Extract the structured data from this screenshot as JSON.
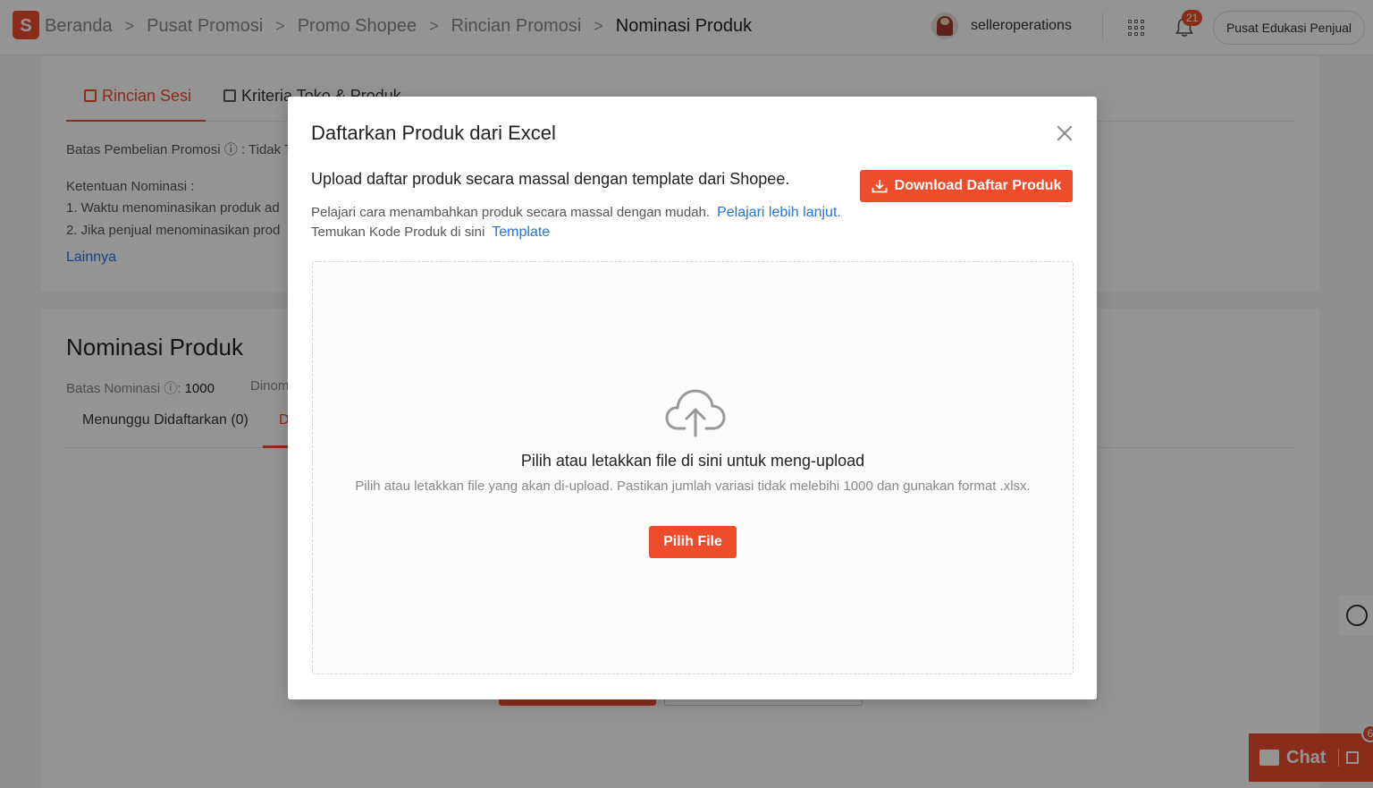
{
  "topbar": {
    "logo": "S",
    "breadcrumbs": [
      "Beranda",
      "Pusat Promosi",
      "Promo Shopee",
      "Rincian Promosi"
    ],
    "current": "Nominasi Produk",
    "username": "selleroperations",
    "notification_count": "21",
    "edu_label": "Pusat Edukasi Penjual"
  },
  "background": {
    "tab_rincian": "Rincian Sesi",
    "tab_kriteria": "Kriteria Toko & Produk",
    "batas_pembelian": "Batas Pembelian Promosi",
    "batas_pembelian_value": ": Tidak T",
    "ketentuan_title": "Ketentuan Nominasi :",
    "ketentuan_1": "1. Waktu menominasikan produk ad",
    "ketentuan_2": "2. Jika penjual menominasikan prod",
    "lainnya": "Lainnya",
    "nominasi_title": "Nominasi Produk",
    "batas_nominasi_label": "Batas Nominasi",
    "batas_nominasi_value": "1000",
    "dinom": "Dinom",
    "tab_menunggu": "Menunggu Didaftarkan (0)",
    "tab_d": "D"
  },
  "modal": {
    "title": "Daftarkan Produk dari Excel",
    "subtitle": "Upload daftar produk secara massal dengan template dari Shopee.",
    "download_button": "Download Daftar Produk",
    "info1": "Pelajari cara menambahkan produk secara massal dengan mudah.",
    "info1_link": "Pelajari lebih lanjut.",
    "info2": "Temukan Kode Produk di sini",
    "info2_link": "Template",
    "dropzone_title": "Pilih atau letakkan file di sini untuk meng-upload",
    "dropzone_desc": "Pilih atau letakkan file yang akan di-upload. Pastikan jumlah variasi tidak melebihi 1000 dan gunakan format .xlsx.",
    "choose_file_button": "Pilih File"
  },
  "chat": {
    "label": "Chat",
    "badge": "6"
  },
  "colors": {
    "accent": "#ee4d2d",
    "link": "#2673dd"
  }
}
